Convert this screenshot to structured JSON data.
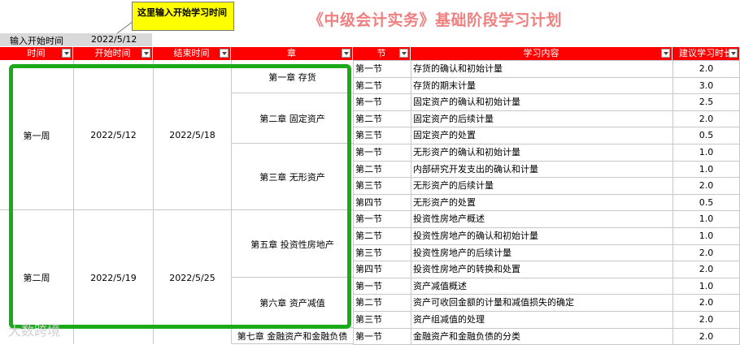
{
  "callout": "这里输入开始学习时间",
  "title": "《中级会计实务》基础阶段学习计划",
  "start_label": "输入开始时间",
  "start_value": "2022/5/12",
  "headers": {
    "time": "时间",
    "start": "开始时间",
    "end": "结束时间",
    "chapter": "章",
    "section": "节",
    "content": "学习内容",
    "hours": "建议学习时长"
  },
  "weeks": [
    {
      "label": "第一周",
      "start": "2022/5/12",
      "end": "2022/5/18"
    },
    {
      "label": "第二周",
      "start": "2022/5/19",
      "end": "2022/5/25"
    }
  ],
  "chapters": [
    "第一章 存货",
    "第二章 固定资产",
    "第三章 无形资产",
    "第五章 投资性房地产",
    "第六章 资产减值",
    "第七章 金融资产和金融负债"
  ],
  "rows": [
    {
      "section": "第一节",
      "content": "存货的确认和初始计量",
      "hours": "2.0"
    },
    {
      "section": "第二节",
      "content": "存货的期末计量",
      "hours": "3.0"
    },
    {
      "section": "第一节",
      "content": "固定资产的确认和初始计量",
      "hours": "2.5"
    },
    {
      "section": "第二节",
      "content": "固定资产的后续计量",
      "hours": "2.0"
    },
    {
      "section": "第三节",
      "content": "固定资产的处置",
      "hours": "0.5"
    },
    {
      "section": "第一节",
      "content": "无形资产的确认和初始计量",
      "hours": "1.0"
    },
    {
      "section": "第二节",
      "content": "内部研究开发支出的确认和计量",
      "hours": "1.0"
    },
    {
      "section": "第三节",
      "content": "无形资产的后续计量",
      "hours": "2.0"
    },
    {
      "section": "第四节",
      "content": "无形资产的处置",
      "hours": "0.5"
    },
    {
      "section": "第一节",
      "content": "投资性房地产概述",
      "hours": "1.0"
    },
    {
      "section": "第二节",
      "content": "投资性房地产的确认和初始计量",
      "hours": "1.0"
    },
    {
      "section": "第三节",
      "content": "投资性房地产的后续计量",
      "hours": "2.0"
    },
    {
      "section": "第四节",
      "content": "投资性房地产的转换和处置",
      "hours": "2.0"
    },
    {
      "section": "第一节",
      "content": "资产减值概述",
      "hours": "1.0"
    },
    {
      "section": "第二节",
      "content": "资产可收回金额的计量和减值损失的确定",
      "hours": "2.0"
    },
    {
      "section": "第三节",
      "content": "资产组减值的处理",
      "hours": "2.0"
    },
    {
      "section": "第一节",
      "content": "金融资产和金融负债的分类",
      "hours": "2.0"
    }
  ],
  "watermark": "大数跨境"
}
